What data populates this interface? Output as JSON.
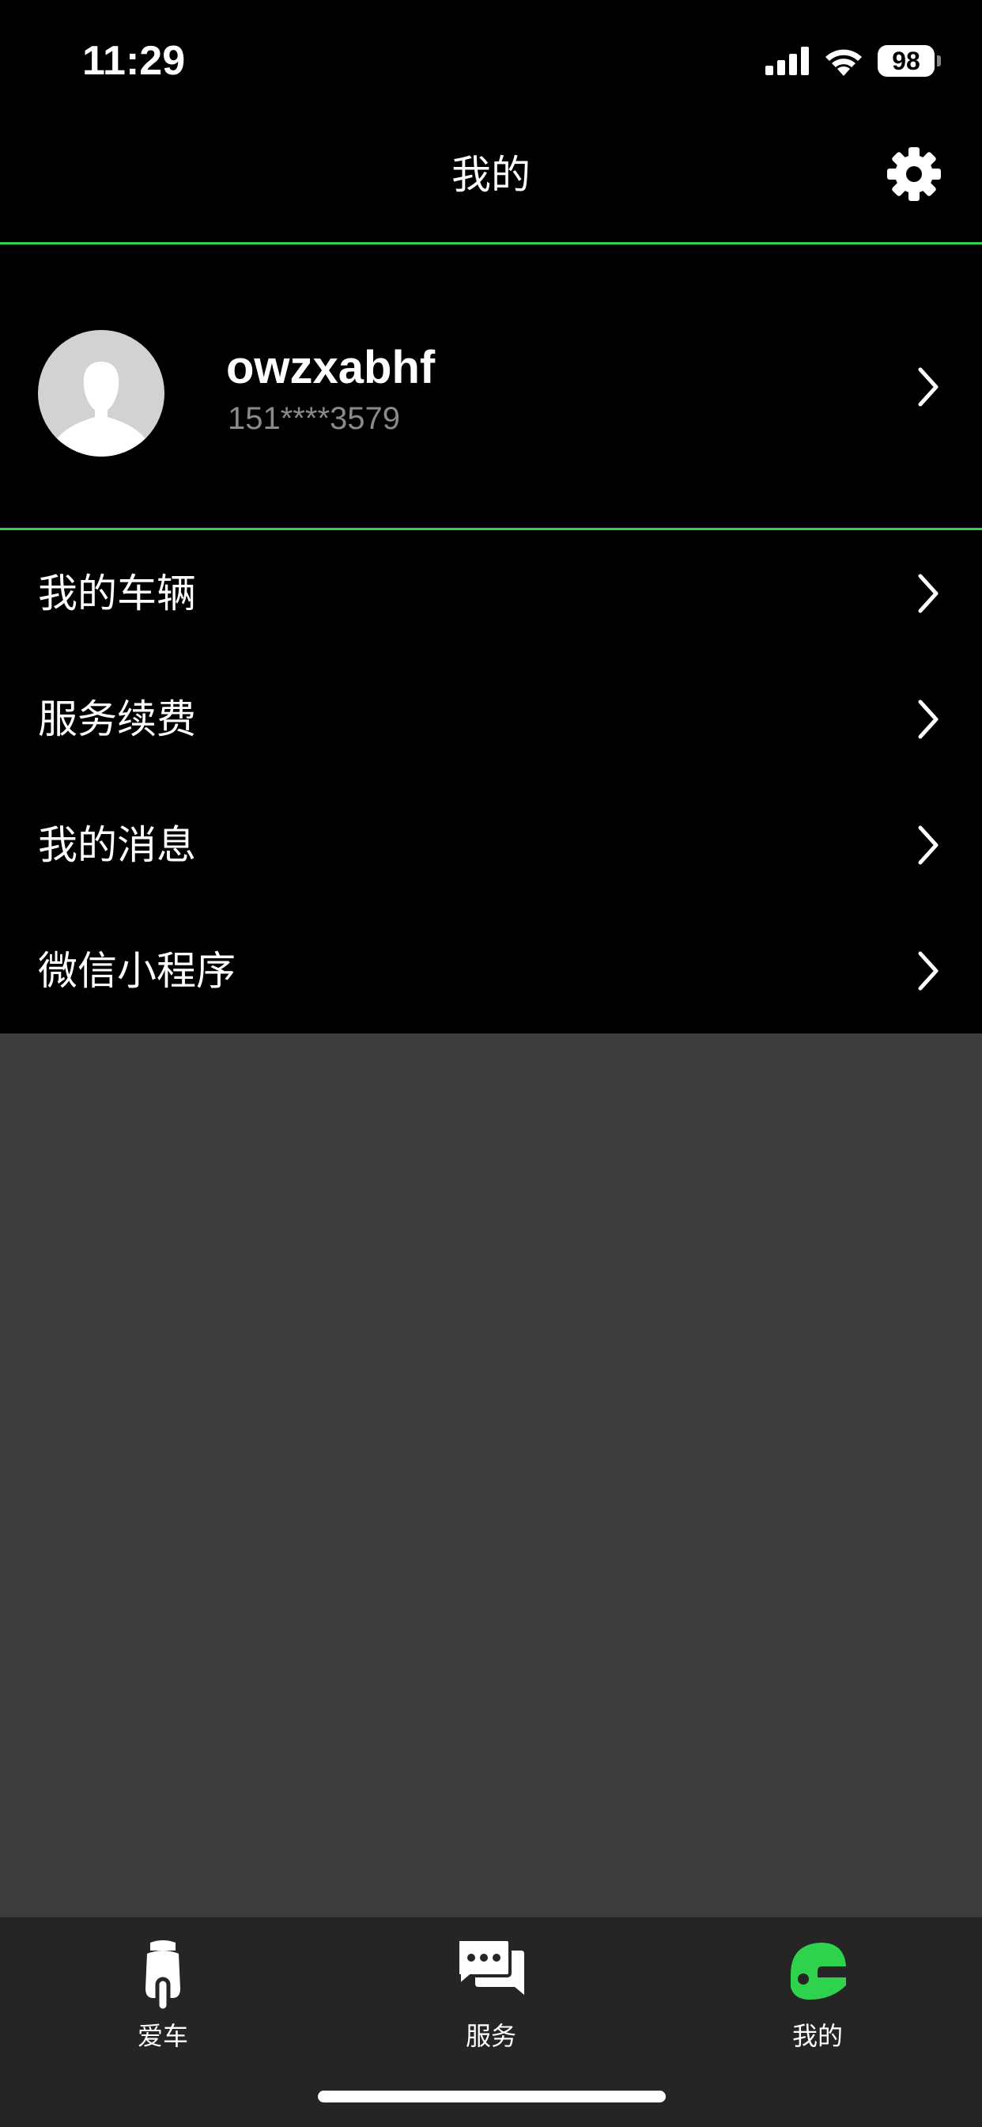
{
  "status_bar": {
    "time": "11:29",
    "battery_level": "98"
  },
  "nav": {
    "title": "我的",
    "settings_icon": "gear-icon"
  },
  "profile": {
    "name": "owzxabhf",
    "phone": "151****3579",
    "avatar_icon": "default-avatar-icon"
  },
  "menu": {
    "items": [
      {
        "label": "我的车辆"
      },
      {
        "label": "服务续费"
      },
      {
        "label": "我的消息"
      },
      {
        "label": "微信小程序"
      }
    ]
  },
  "tabbar": {
    "tabs": [
      {
        "label": "爱车",
        "icon": "scooter-icon",
        "active": false
      },
      {
        "label": "服务",
        "icon": "chat-bubbles-icon",
        "active": false
      },
      {
        "label": "我的",
        "icon": "helmet-icon",
        "active": true
      }
    ]
  },
  "colors": {
    "accent": "#2fd24d",
    "background": "#000000",
    "content_background": "#3c3c3c",
    "tabbar_background": "#252525"
  }
}
